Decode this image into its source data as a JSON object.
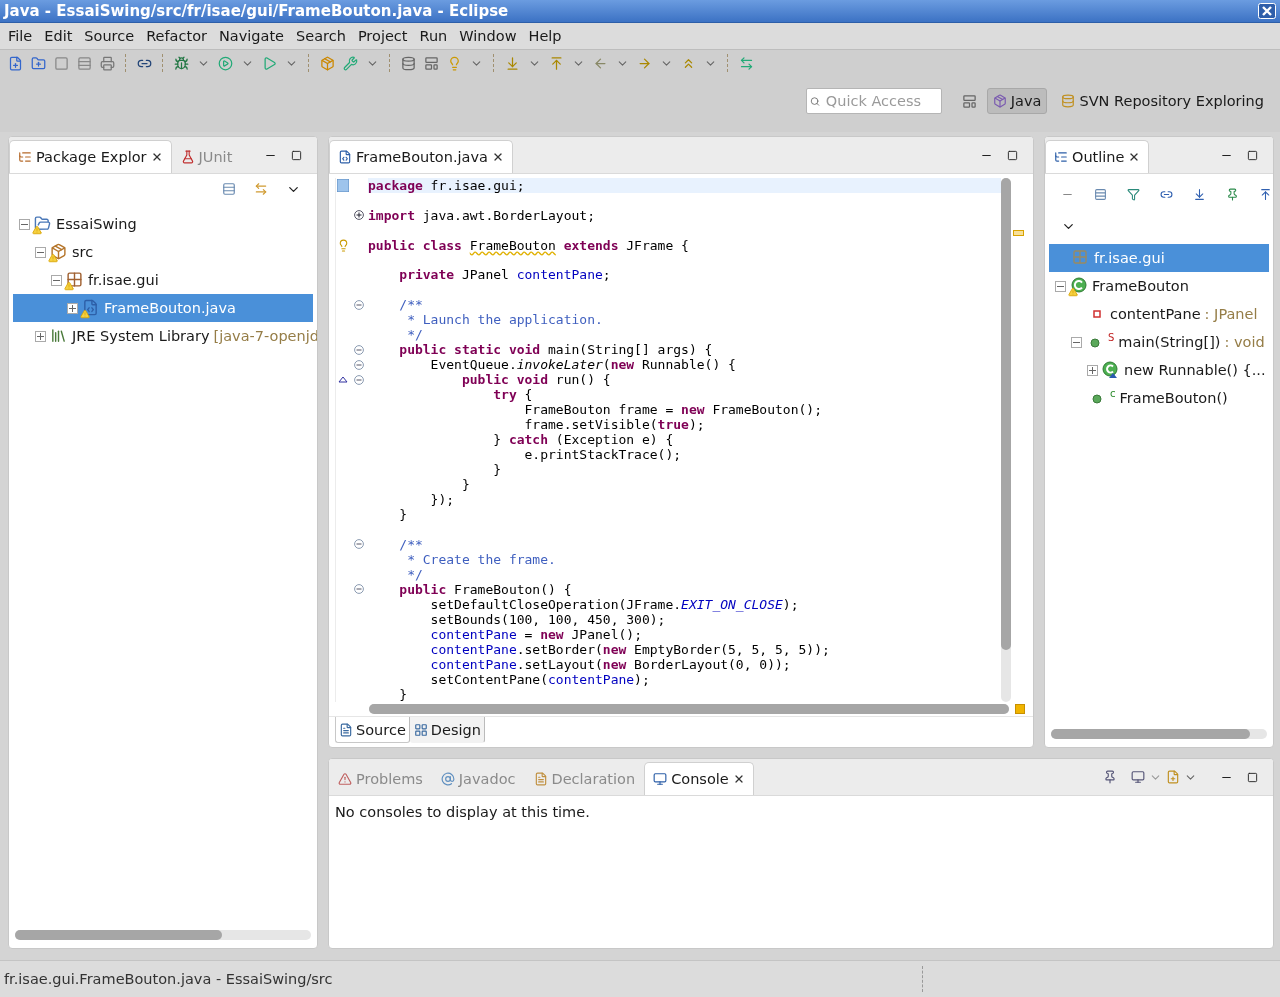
{
  "window": {
    "title": "Java - EssaiSwing/src/fr/isae/gui/FrameBouton.java - Eclipse"
  },
  "menu": [
    "File",
    "Edit",
    "Source",
    "Refactor",
    "Navigate",
    "Search",
    "Project",
    "Run",
    "Window",
    "Help"
  ],
  "quick_access": {
    "placeholder": "Quick Access"
  },
  "perspectives": [
    {
      "label": "Java",
      "kind": "java",
      "selected": true
    },
    {
      "label": "SVN Repository Exploring",
      "kind": "svn",
      "selected": false
    }
  ],
  "package_explorer": {
    "tabs": [
      {
        "label": "Package Explor",
        "kind": "package",
        "selected": true
      },
      {
        "label": "JUnit",
        "kind": "junit",
        "selected": false
      }
    ],
    "tree": [
      {
        "label": "EssaiSwing",
        "kind": "project",
        "warning": true,
        "expanded": true,
        "selected": false,
        "children": [
          {
            "label": "src",
            "kind": "source-folder",
            "warning": true,
            "expanded": true,
            "selected": false,
            "children": [
              {
                "label": "fr.isae.gui",
                "kind": "package",
                "warning": true,
                "expanded": true,
                "selected": false,
                "children": [
                  {
                    "label": "FrameBouton.java",
                    "kind": "java-file",
                    "warning": true,
                    "expanded": false,
                    "selected": true
                  }
                ]
              }
            ]
          },
          {
            "label": "JRE System Library",
            "suffix": "[java-7-openjd",
            "kind": "library",
            "warning": false,
            "expanded": false,
            "selected": false
          }
        ]
      }
    ]
  },
  "editor": {
    "tabs": [
      {
        "label": "FrameBouton.java",
        "selected": true
      }
    ],
    "lines": [
      {
        "kind": "code",
        "current": true,
        "gutter": {
          "kind": "bookmark"
        },
        "segments": [
          {
            "kind": "keyword",
            "text": "package"
          },
          {
            "kind": "plain",
            "text": " fr.isae.gui;"
          }
        ]
      },
      {
        "kind": "blank"
      },
      {
        "kind": "code",
        "foldable": true,
        "expanded": false,
        "segments": [
          {
            "kind": "keyword",
            "text": "import"
          },
          {
            "kind": "plain",
            "text": " java.awt.BorderLayout;"
          }
        ]
      },
      {
        "kind": "blank"
      },
      {
        "kind": "code",
        "gutter": {
          "kind": "warning"
        },
        "segments": [
          {
            "kind": "keyword",
            "text": "public class "
          },
          {
            "kind": "warning-underline",
            "text": "FrameBouton"
          },
          {
            "kind": "keyword",
            "text": " extends"
          },
          {
            "kind": "plain",
            "text": " JFrame {"
          }
        ]
      },
      {
        "kind": "blank"
      },
      {
        "kind": "code",
        "segments": [
          {
            "kind": "keyword",
            "text": "    private"
          },
          {
            "kind": "plain",
            "text": " JPanel "
          },
          {
            "kind": "field",
            "text": "contentPane"
          },
          {
            "kind": "plain",
            "text": ";"
          }
        ]
      },
      {
        "kind": "blank"
      },
      {
        "kind": "code",
        "foldable": true,
        "expanded": true,
        "segments": [
          {
            "kind": "comment",
            "text": "    /**"
          }
        ]
      },
      {
        "kind": "code",
        "segments": [
          {
            "kind": "comment",
            "text": "     * Launch the application."
          }
        ]
      },
      {
        "kind": "code",
        "segments": [
          {
            "kind": "comment",
            "text": "     */"
          }
        ]
      },
      {
        "kind": "code",
        "foldable": true,
        "expanded": true,
        "segments": [
          {
            "kind": "keyword",
            "text": "    public static void"
          },
          {
            "kind": "plain",
            "text": " main(String[] args) {"
          }
        ]
      },
      {
        "kind": "code",
        "foldable": true,
        "expanded": true,
        "segments": [
          {
            "kind": "plain",
            "text": "        EventQueue."
          },
          {
            "kind": "italic",
            "text": "invokeLater"
          },
          {
            "kind": "plain",
            "text": "("
          },
          {
            "kind": "keyword",
            "text": "new"
          },
          {
            "kind": "plain",
            "text": " Runnable() {"
          }
        ]
      },
      {
        "kind": "code",
        "foldable": true,
        "expanded": true,
        "gutter": {
          "kind": "override"
        },
        "segments": [
          {
            "kind": "keyword",
            "text": "            public void"
          },
          {
            "kind": "plain",
            "text": " run() {"
          }
        ]
      },
      {
        "kind": "code",
        "segments": [
          {
            "kind": "keyword",
            "text": "                try"
          },
          {
            "kind": "plain",
            "text": " {"
          }
        ]
      },
      {
        "kind": "code",
        "segments": [
          {
            "kind": "plain",
            "text": "                    FrameBouton frame = "
          },
          {
            "kind": "keyword",
            "text": "new"
          },
          {
            "kind": "plain",
            "text": " FrameBouton();"
          }
        ]
      },
      {
        "kind": "code",
        "segments": [
          {
            "kind": "plain",
            "text": "                    frame.setVisible("
          },
          {
            "kind": "keyword",
            "text": "true"
          },
          {
            "kind": "plain",
            "text": ");"
          }
        ]
      },
      {
        "kind": "code",
        "segments": [
          {
            "kind": "plain",
            "text": "                } "
          },
          {
            "kind": "keyword",
            "text": "catch"
          },
          {
            "kind": "plain",
            "text": " (Exception e) {"
          }
        ]
      },
      {
        "kind": "code",
        "segments": [
          {
            "kind": "plain",
            "text": "                    e.printStackTrace();"
          }
        ]
      },
      {
        "kind": "code",
        "segments": [
          {
            "kind": "plain",
            "text": "                }"
          }
        ]
      },
      {
        "kind": "code",
        "segments": [
          {
            "kind": "plain",
            "text": "            }"
          }
        ]
      },
      {
        "kind": "code",
        "segments": [
          {
            "kind": "plain",
            "text": "        });"
          }
        ]
      },
      {
        "kind": "code",
        "segments": [
          {
            "kind": "plain",
            "text": "    }"
          }
        ]
      },
      {
        "kind": "blank"
      },
      {
        "kind": "code",
        "foldable": true,
        "expanded": true,
        "segments": [
          {
            "kind": "comment",
            "text": "    /**"
          }
        ]
      },
      {
        "kind": "code",
        "segments": [
          {
            "kind": "comment",
            "text": "     * Create the frame."
          }
        ]
      },
      {
        "kind": "code",
        "segments": [
          {
            "kind": "comment",
            "text": "     */"
          }
        ]
      },
      {
        "kind": "code",
        "foldable": true,
        "expanded": true,
        "segments": [
          {
            "kind": "keyword",
            "text": "    public"
          },
          {
            "kind": "plain",
            "text": " FrameBouton() {"
          }
        ]
      },
      {
        "kind": "code",
        "segments": [
          {
            "kind": "plain",
            "text": "        setDefaultCloseOperation(JFrame."
          },
          {
            "kind": "constant",
            "text": "EXIT_ON_CLOSE"
          },
          {
            "kind": "plain",
            "text": ");"
          }
        ]
      },
      {
        "kind": "code",
        "segments": [
          {
            "kind": "plain",
            "text": "        setBounds(100, 100, 450, 300);"
          }
        ]
      },
      {
        "kind": "code",
        "segments": [
          {
            "kind": "field",
            "text": "        contentPane"
          },
          {
            "kind": "plain",
            "text": " = "
          },
          {
            "kind": "keyword",
            "text": "new"
          },
          {
            "kind": "plain",
            "text": " JPanel();"
          }
        ]
      },
      {
        "kind": "code",
        "segments": [
          {
            "kind": "field",
            "text": "        contentPane"
          },
          {
            "kind": "plain",
            "text": ".setBorder("
          },
          {
            "kind": "keyword",
            "text": "new"
          },
          {
            "kind": "plain",
            "text": " EmptyBorder(5, 5, 5, 5));"
          }
        ]
      },
      {
        "kind": "code",
        "segments": [
          {
            "kind": "field",
            "text": "        contentPane"
          },
          {
            "kind": "plain",
            "text": ".setLayout("
          },
          {
            "kind": "keyword",
            "text": "new"
          },
          {
            "kind": "plain",
            "text": " BorderLayout(0, 0));"
          }
        ]
      },
      {
        "kind": "code",
        "segments": [
          {
            "kind": "plain",
            "text": "        setContentPane("
          },
          {
            "kind": "field",
            "text": "contentPane"
          },
          {
            "kind": "plain",
            "text": ");"
          }
        ]
      },
      {
        "kind": "code",
        "segments": [
          {
            "kind": "plain",
            "text": "    }"
          }
        ]
      }
    ],
    "bottom_tabs": [
      {
        "label": "Source",
        "kind": "source",
        "selected": true
      },
      {
        "label": "Design",
        "kind": "design",
        "selected": false
      }
    ]
  },
  "outline": {
    "tabs": [
      {
        "label": "Outline",
        "selected": true
      }
    ],
    "tree": [
      {
        "label": "fr.isae.gui",
        "kind": "package",
        "selected": true
      },
      {
        "label": "FrameBouton",
        "kind": "class",
        "selected": false,
        "expanded": true,
        "children": [
          {
            "label": "contentPane",
            "type": ": JPanel",
            "kind": "field",
            "selected": false
          },
          {
            "label": "main(String[])",
            "modifier": "S",
            "type": ": void",
            "kind": "method",
            "selected": false,
            "expanded": true,
            "children": [
              {
                "label": "new Runnable() {...",
                "kind": "anonymous",
                "selected": false,
                "expanded": false
              }
            ]
          },
          {
            "label": "FrameBouton()",
            "modifier": "c",
            "kind": "method",
            "selected": false
          }
        ]
      }
    ]
  },
  "bottom_panel": {
    "tabs": [
      {
        "label": "Problems",
        "kind": "problems",
        "selected": false
      },
      {
        "label": "Javadoc",
        "kind": "javadoc",
        "selected": false
      },
      {
        "label": "Declaration",
        "kind": "declaration",
        "selected": false
      },
      {
        "label": "Console",
        "kind": "console",
        "selected": true
      }
    ],
    "message": "No consoles to display at this time."
  },
  "status_bar": {
    "text": "fr.isae.gui.FrameBouton.java - EssaiSwing/src"
  }
}
